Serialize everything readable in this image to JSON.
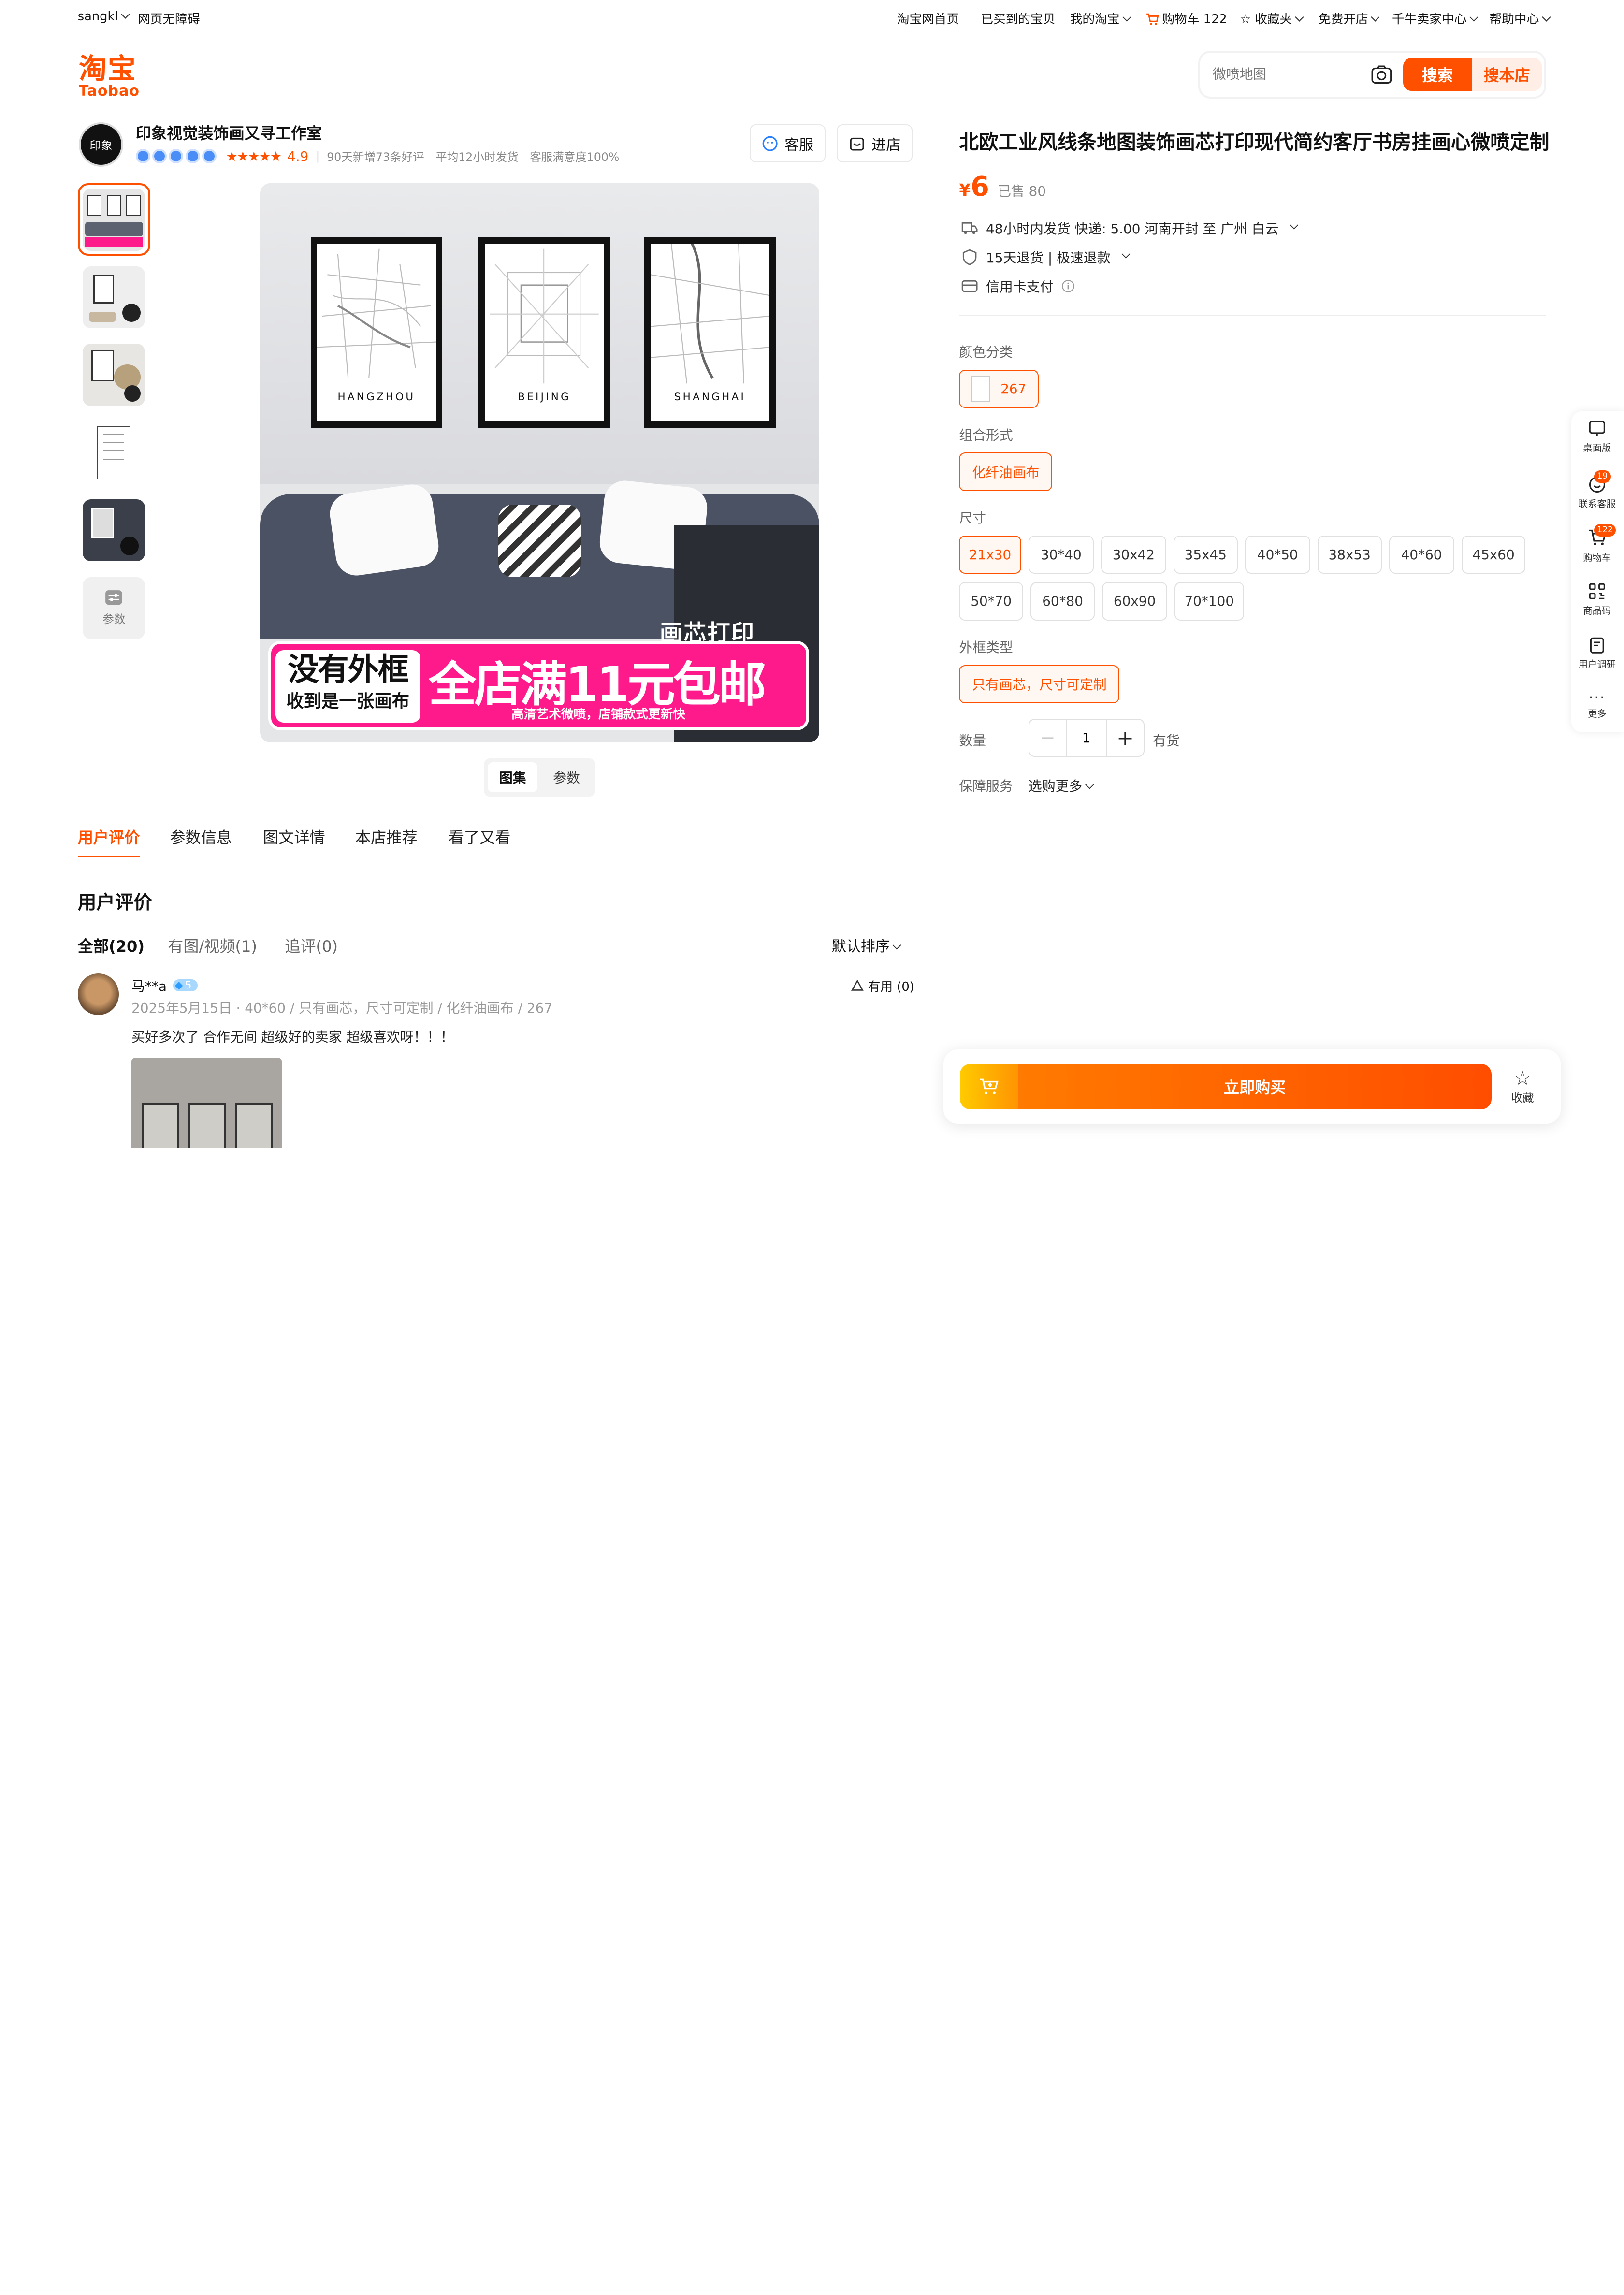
{
  "topbar": {
    "user": "sangkl",
    "accessible": "网页无障碍",
    "home": "淘宝网首页",
    "bought": "已买到的宝贝",
    "my_taobao": "我的淘宝",
    "cart": "购物车 122",
    "favorites": "收藏夹",
    "open_shop": "免费开店",
    "seller_center": "千牛卖家中心",
    "help": "帮助中心"
  },
  "logo": {
    "cn": "淘宝",
    "en": "Taobao"
  },
  "search": {
    "placeholder": "微喷地图",
    "search_btn": "搜索",
    "shop_search_btn": "搜本店"
  },
  "shop": {
    "avatar_text": "印象",
    "name": "印象视觉装饰画又寻工作室",
    "rating": "4.9",
    "new_reviews": "90天新增73条好评",
    "ship_time": "平均12小时发货",
    "satisfaction": "客服满意度100%",
    "service_btn": "客服",
    "enter_btn": "进店"
  },
  "gallery": {
    "params_thumb": "参数",
    "tabs": [
      "图集",
      "参数"
    ],
    "main_image": {
      "maps": [
        "HANGZHOU",
        "BEIJING",
        "SHANGHAI"
      ],
      "banner_left_1": "没有外框",
      "banner_left_2": "收到是一张画布",
      "banner_main": "全店满11元包邮",
      "banner_sub": "高清艺术微喷，店铺款式更新快",
      "corner_text": "画芯打印"
    }
  },
  "product": {
    "title": "北欧工业风线条地图装饰画芯打印现代简约客厅书房挂画心微喷定制",
    "currency": "¥",
    "price": "6",
    "sold": "已售 80",
    "shipping": "48小时内发货  快递: 5.00  河南开封 至 广州 白云",
    "returns": "15天退货  |  极速退款",
    "payment": "信用卡支付"
  },
  "options": {
    "color_label": "颜色分类",
    "color": "267",
    "combo_label": "组合形式",
    "combo": "化纤油画布",
    "size_label": "尺寸",
    "sizes": [
      "21x30",
      "30*40",
      "30x42",
      "35x45",
      "40*50",
      "38x53",
      "40*60",
      "45x60",
      "50*70",
      "60*80",
      "60x90",
      "70*100"
    ],
    "frame_label": "外框类型",
    "frame": "只有画芯，尺寸可定制",
    "qty_label": "数量",
    "qty": "1",
    "stock": "有货",
    "guarantee_label": "保障服务",
    "guarantee": "选购更多"
  },
  "detail_tabs": [
    "用户评价",
    "参数信息",
    "图文详情",
    "本店推荐",
    "看了又看"
  ],
  "reviews": {
    "heading": "用户评价",
    "filters": [
      "全部(20)",
      "有图/视频(1)",
      "追评(0)"
    ],
    "sort": "默认排序",
    "item": {
      "user": "马**a",
      "level": "5",
      "meta": "2025年5月15日 · 40*60 / 只有画芯，尺寸可定制 / 化纤油画布 / 267",
      "text": "买好多次了 合作无间 超级好的卖家 超级喜欢呀！！！",
      "helpful": "有用 (0)"
    }
  },
  "sidebar": [
    {
      "label": "桌面版"
    },
    {
      "label": "联系客服",
      "badge": "19"
    },
    {
      "label": "购物车",
      "badge": "122"
    },
    {
      "label": "商品码"
    },
    {
      "label": "用户调研"
    },
    {
      "label": "更多"
    }
  ],
  "buybar": {
    "buy": "立即购买",
    "fav": "收藏"
  },
  "colors": {
    "brand": "#ff5000",
    "banner_pink": "#ff1a8c"
  }
}
